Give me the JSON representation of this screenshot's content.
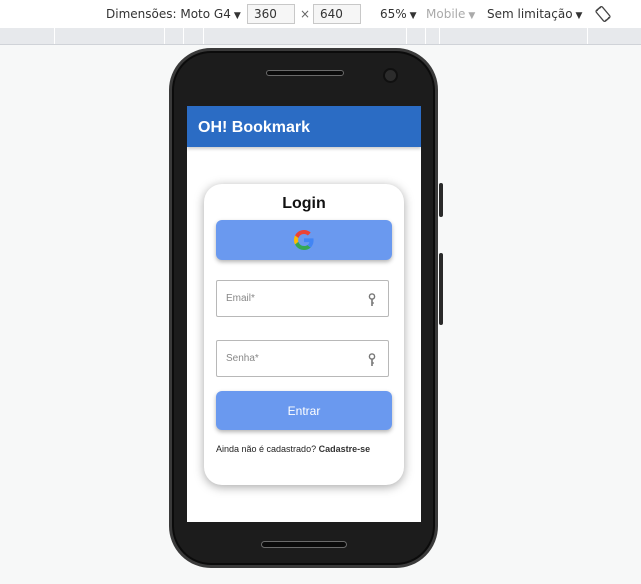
{
  "devtools": {
    "device_label": "Dimensões: Moto G4",
    "width_value": "360",
    "times": "×",
    "height_value": "640",
    "zoom": "65%",
    "mode": "Mobile",
    "throttle": "Sem limitação",
    "caret": "▼",
    "rotate_icon": "rotate-icon"
  },
  "app": {
    "title": "OH! Bookmark",
    "accent_color": "#2b6cc4",
    "button_color": "#6a99ef"
  },
  "login": {
    "title": "Login",
    "google_icon": "google-icon",
    "email_placeholder": "Email*",
    "password_placeholder": "Senha*",
    "field_icon": "key-icon",
    "submit_label": "Entrar",
    "signup_prompt": "Ainda não é cadastrado?",
    "signup_link": "Cadastre-se"
  }
}
